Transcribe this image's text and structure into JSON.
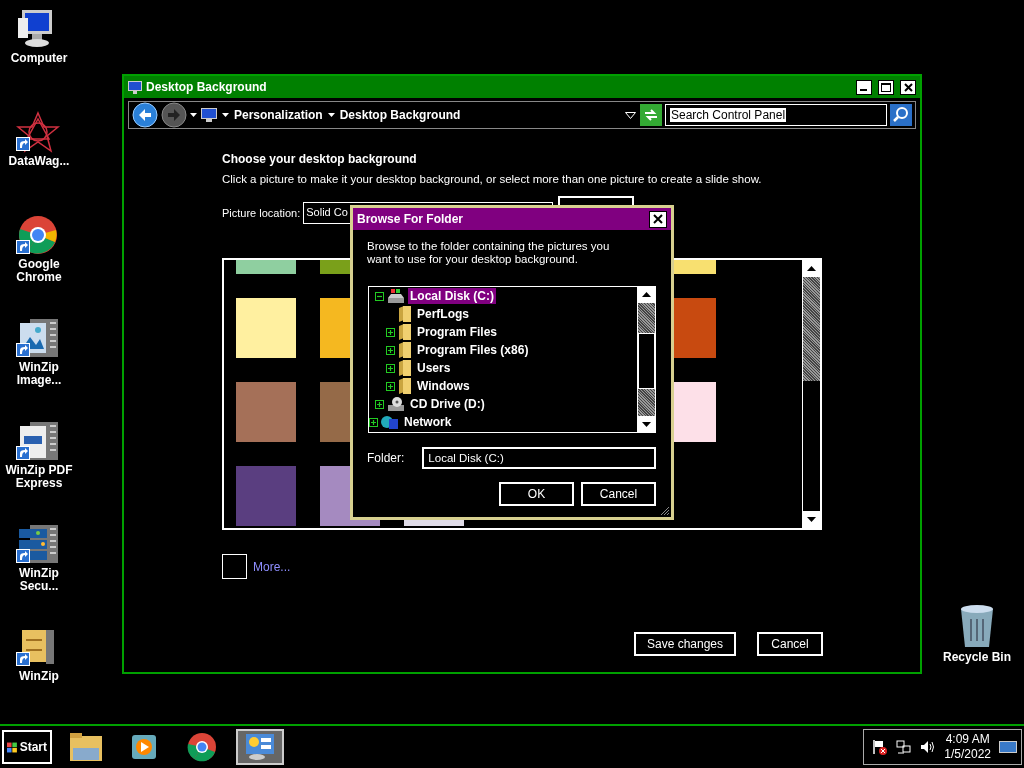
{
  "desktop_icons": [
    {
      "label": "Computer",
      "kind": "computer",
      "shortcut": false
    },
    {
      "label": "DataWag...",
      "kind": "star",
      "shortcut": true
    },
    {
      "label": "Google Chrome",
      "kind": "chrome",
      "shortcut": true
    },
    {
      "label": "WinZip Image...",
      "kind": "zip-image",
      "shortcut": true
    },
    {
      "label": "WinZip PDF Express",
      "kind": "zip-pdf",
      "shortcut": true
    },
    {
      "label": "WinZip Secu...",
      "kind": "zip-secure",
      "shortcut": true
    },
    {
      "label": "WinZip",
      "kind": "zip",
      "shortcut": true
    }
  ],
  "recycle_bin": {
    "label": "Recycle Bin"
  },
  "window": {
    "title": "Desktop Background",
    "breadcrumbs": [
      "Personalization",
      "Desktop Background"
    ],
    "search": {
      "value": "Search Control Panel"
    },
    "heading": "Choose your desktop background",
    "instructions": "Click a picture to make it your desktop background, or select more than one picture to create a slide show.",
    "picture_location": {
      "label": "Picture location:",
      "value": "Solid Co"
    },
    "swatch_rows": [
      [
        {
          "color": "#8fcfa0"
        },
        {
          "color": "#7aa01a"
        },
        null,
        null,
        null,
        {
          "color": "#f8e070"
        }
      ],
      [
        {
          "color": "#fff0a0"
        },
        {
          "color": "#f5b820"
        },
        null,
        null,
        null,
        {
          "color": "#c84a10"
        }
      ],
      [
        {
          "color": "#a57058"
        },
        {
          "color": "#956a48"
        },
        null,
        null,
        null,
        {
          "color": "#fde0e8"
        }
      ],
      [
        {
          "color": "#5a3e80"
        },
        {
          "color": "#a58ac0"
        },
        {
          "color": "#e0dce8"
        },
        null,
        null,
        null
      ]
    ],
    "more_link": "More...",
    "buttons": [
      "Save changes",
      "Cancel"
    ]
  },
  "dialog": {
    "title": "Browse For Folder",
    "instructions": "Browse to the folder containing the pictures you want to use for your desktop background.",
    "tree": [
      {
        "children": [
          {
            "label": "Local Disk (C:)",
            "kind": "drive",
            "selected": true,
            "expandable": true,
            "expanded": true,
            "children": [
              {
                "label": "PerfLogs",
                "kind": "folder",
                "selected": false,
                "expandable": false
              },
              {
                "label": "Program Files",
                "kind": "folder",
                "selected": false,
                "expandable": true,
                "expanded": false
              },
              {
                "label": "Program Files (x86)",
                "kind": "folder",
                "selected": false,
                "expandable": true,
                "expanded": false
              },
              {
                "label": "Users",
                "kind": "folder",
                "selected": false,
                "expandable": true,
                "expanded": false
              },
              {
                "label": "Windows",
                "kind": "folder",
                "selected": false,
                "expandable": true,
                "expanded": false
              }
            ]
          },
          {
            "label": "CD Drive (D:)",
            "kind": "cd",
            "selected": false,
            "expandable": true,
            "expanded": false
          }
        ]
      },
      {
        "label": "Network",
        "kind": "network",
        "selected": false,
        "expandable": true,
        "expanded": false
      }
    ],
    "folder": {
      "label": "Folder:",
      "value": "Local Disk (C:)"
    },
    "buttons": [
      "OK",
      "Cancel"
    ]
  },
  "taskbar": {
    "start": "Start",
    "apps": [
      {
        "kind": "explorer",
        "selected": false
      },
      {
        "kind": "media",
        "selected": false
      },
      {
        "kind": "chrome",
        "selected": false
      },
      {
        "kind": "control-panel",
        "selected": true
      }
    ],
    "time": "4:09 AM",
    "date": "1/5/2022"
  }
}
